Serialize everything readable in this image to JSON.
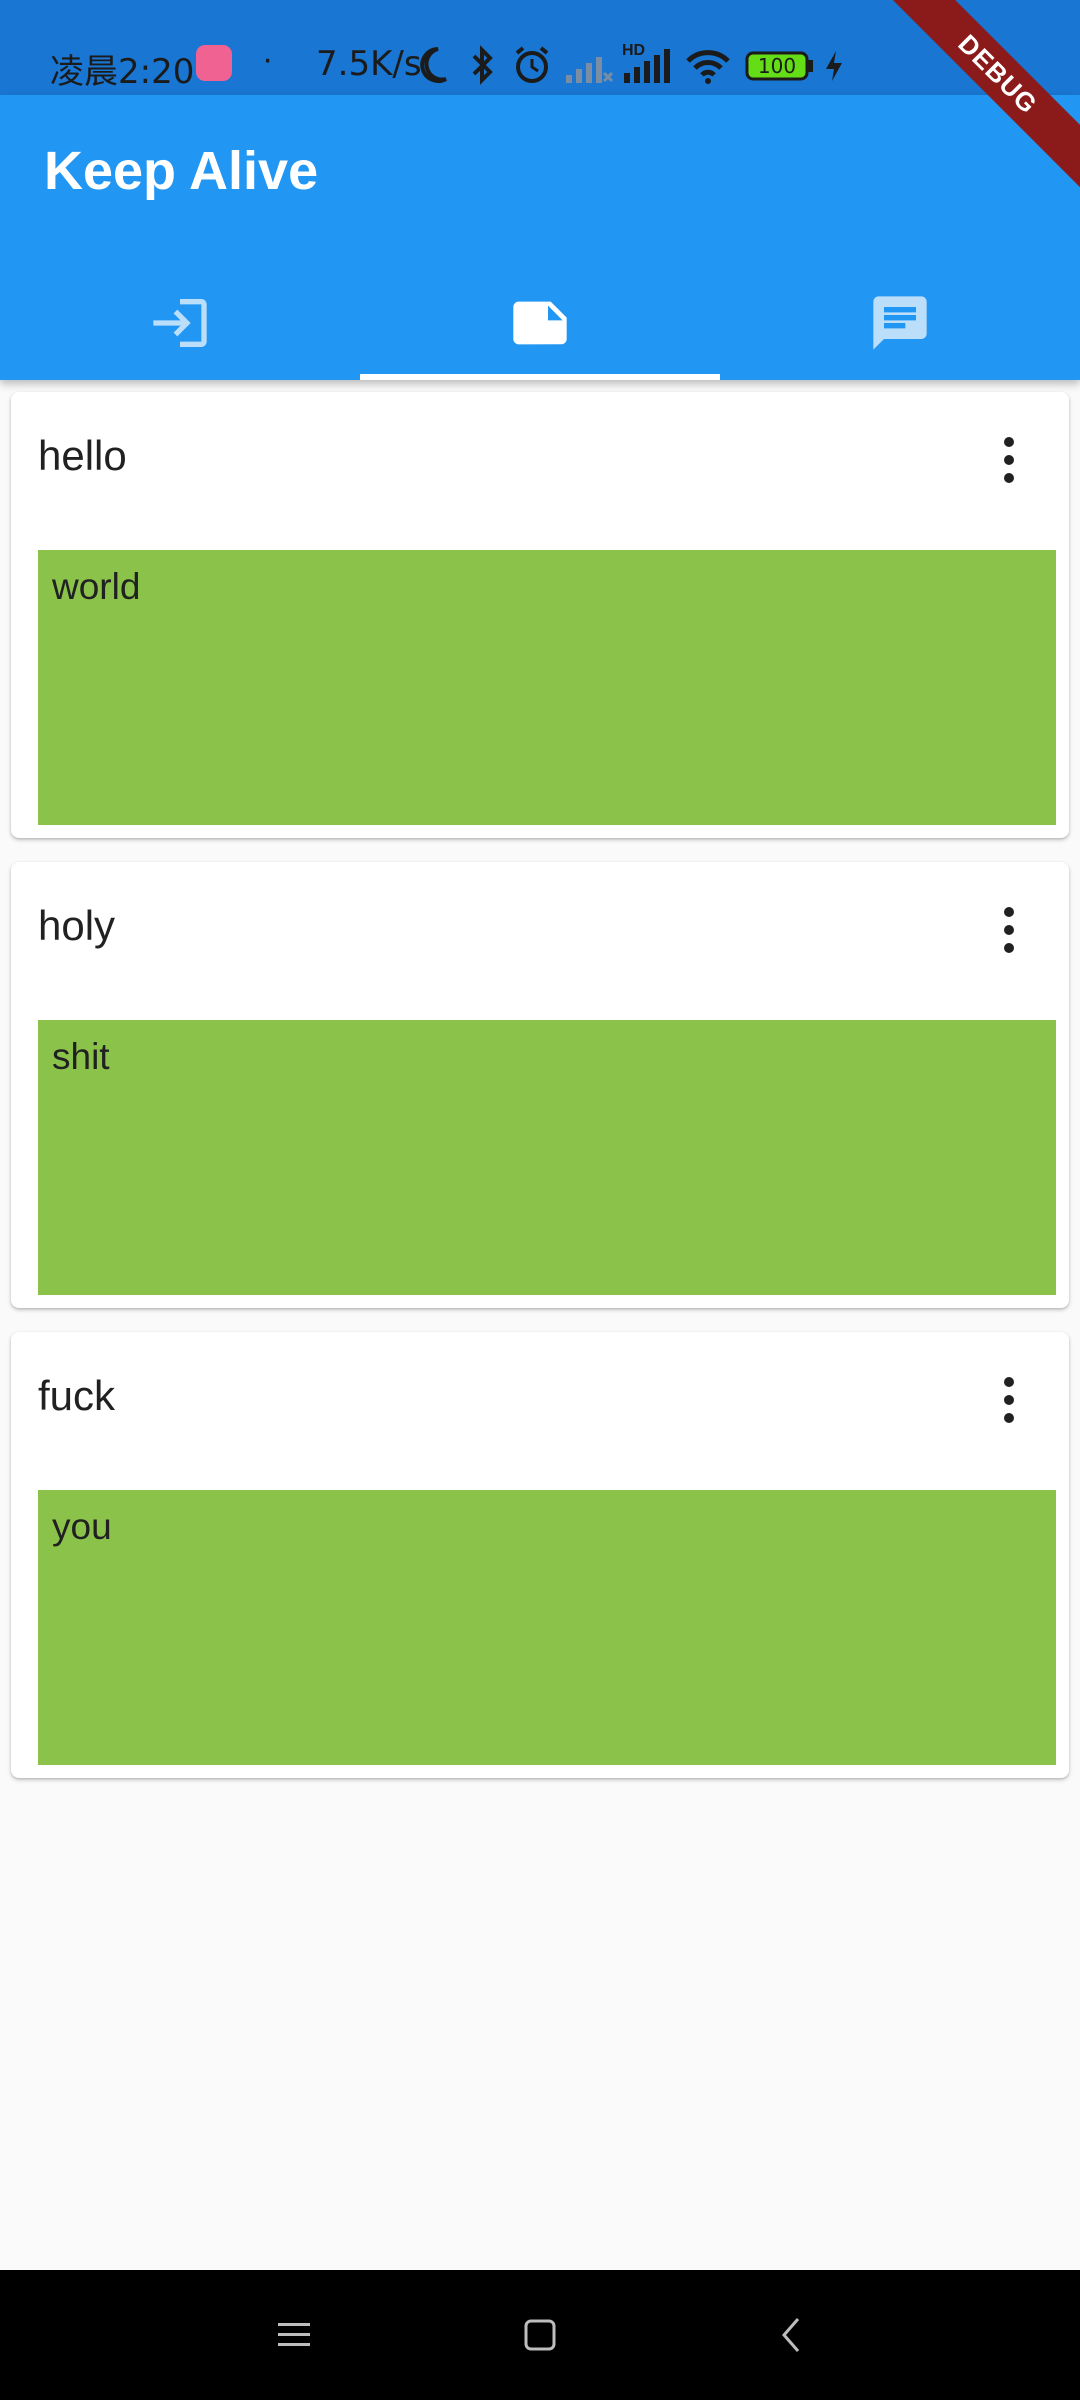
{
  "status_bar": {
    "time": "凌晨2:20",
    "separator": "·",
    "net_speed": "7.5K/s",
    "hd_label": "HD",
    "battery": "100",
    "icons": [
      "bilibili-app-icon",
      "moon-icon",
      "bluetooth-icon",
      "alarm-icon",
      "signal-icon",
      "signal-hd-icon",
      "wifi-icon",
      "battery-icon",
      "charging-icon"
    ]
  },
  "debug_banner": "DEBUG",
  "app_bar": {
    "title": "Keep Alive",
    "tabs": [
      {
        "icon": "login-icon",
        "active": false
      },
      {
        "icon": "note-icon",
        "active": true
      },
      {
        "icon": "chat-icon",
        "active": false
      }
    ]
  },
  "cards": [
    {
      "title": "hello",
      "body": "world"
    },
    {
      "title": "holy",
      "body": "shit"
    },
    {
      "title": "fuck",
      "body": "you"
    }
  ],
  "colors": {
    "status_bar": "#1976d2",
    "app_bar": "#2196f3",
    "panel": "#8bc34a",
    "background": "#fafafa",
    "debug": "#8b1a1a"
  },
  "nav_bar": {
    "icons": [
      "menu-icon",
      "home-icon",
      "back-icon"
    ]
  }
}
